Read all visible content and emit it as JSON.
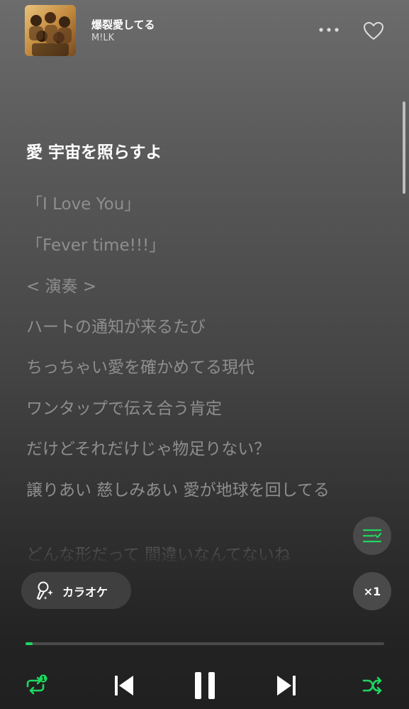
{
  "header": {
    "title": "爆裂愛してる",
    "artist": "M!LK",
    "more_icon": "more-horizontal-icon",
    "like_icon": "heart-outline-icon"
  },
  "lyrics": [
    {
      "text": "愛 宇宙を照らすよ",
      "active": true
    },
    {
      "text": "「I Love You」",
      "active": false
    },
    {
      "text": "「Fever time!!!」",
      "active": false
    },
    {
      "text": "< 演奏 >",
      "active": false
    },
    {
      "text": "ハートの通知が来るたび",
      "active": false
    },
    {
      "text": "ちっちゃい愛を確かめてる現代",
      "active": false
    },
    {
      "text": "ワンタップで伝え合う肯定",
      "active": false
    },
    {
      "text": "だけどそれだけじゃ物足りない？",
      "active": false
    },
    {
      "text": "譲りあい 慈しみあい 愛が地球を回してる",
      "active": false
    },
    {
      "text": "どんな形だって 間違いなんてないね",
      "active": false
    }
  ],
  "karaoke": {
    "label": "カラオケ",
    "icon": "microphone-sparkle-icon"
  },
  "speed": {
    "label": "×1"
  },
  "queue_icon": "lyrics-list-icon",
  "progress": {
    "fraction": 0.02
  },
  "controls": {
    "repeat_badge": "1",
    "repeat_icon": "repeat-one-icon",
    "previous_icon": "skip-previous-icon",
    "pause_icon": "pause-icon",
    "next_icon": "skip-next-icon",
    "shuffle_icon": "shuffle-icon"
  },
  "colors": {
    "accent": "#1ed760",
    "active_lyric": "#ffffff",
    "inactive_lyric": "#8e8e8e"
  }
}
